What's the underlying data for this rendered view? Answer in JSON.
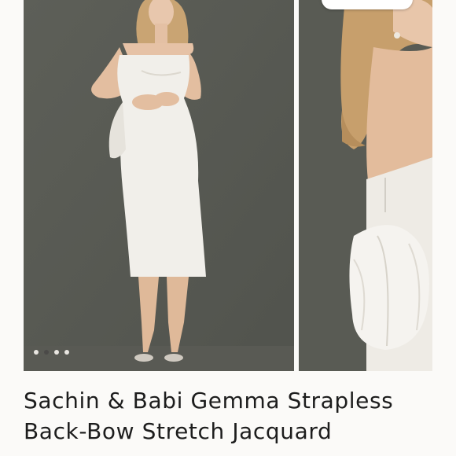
{
  "product": {
    "title": "Sachin & Babi Gemma Strapless Back-Bow Stretch Jacquard"
  },
  "carousel": {
    "slide_count": 4,
    "active_index": 1,
    "images": [
      {
        "alt": "front view"
      },
      {
        "alt": "back view"
      }
    ]
  },
  "badge": {
    "text": ""
  },
  "colors": {
    "background": "#fbfaf8",
    "photo_backdrop": "#585a53",
    "dot_active": "#4b4a48",
    "dot_inactive": "#e9e6e1"
  }
}
